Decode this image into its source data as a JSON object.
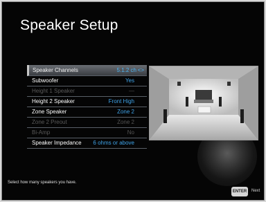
{
  "screen": {
    "title": "Speaker Setup"
  },
  "menu": {
    "items": [
      {
        "label": "Speaker Channels",
        "value": "5.1.2 ch",
        "arrows": "<>",
        "state": "selected"
      },
      {
        "label": "Subwoofer",
        "value": "Yes",
        "state": "on"
      },
      {
        "label": "Height 1 Speaker",
        "value": "—",
        "state": "off"
      },
      {
        "label": "Height 2 Speaker",
        "value": "Front High",
        "state": "on"
      },
      {
        "label": "Zone Speaker",
        "value": "Zone 2",
        "state": "on"
      },
      {
        "label": "Zone 2 Preout",
        "value": "Zone 2",
        "state": "off"
      },
      {
        "label": "Bi-Amp",
        "value": "No",
        "state": "off"
      },
      {
        "label": "Speaker Impedance",
        "value": "6 ohms or above",
        "state": "on"
      }
    ]
  },
  "help_text": "Select how many speakers you have.",
  "footer": {
    "enter_label": "ENTER",
    "next_label": "Next"
  },
  "colors": {
    "value_blue": "#3fa3e8",
    "background": "#050505"
  }
}
